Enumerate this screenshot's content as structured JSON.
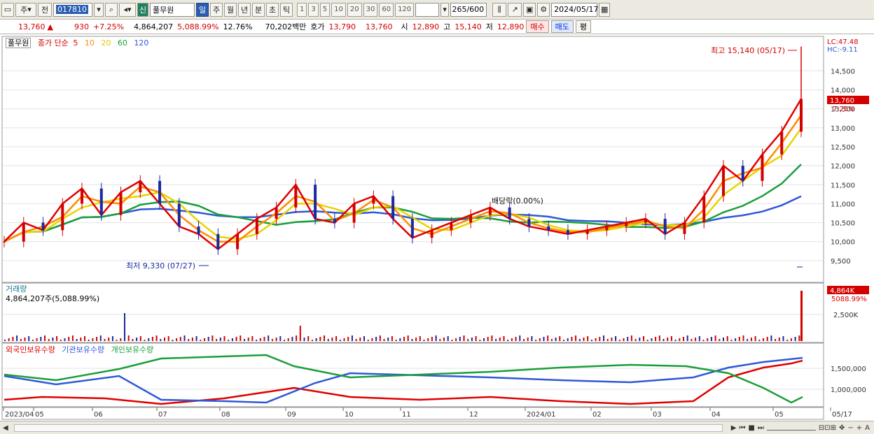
{
  "toolbar": {
    "market_label": "주",
    "prev_label": "전",
    "code_value": "017810",
    "stock_badge": "신",
    "stock_name": "풀무원",
    "periods": [
      "일",
      "주",
      "월",
      "년",
      "분",
      "초",
      "틱"
    ],
    "selected_period": "일",
    "intervals": [
      "1",
      "3",
      "5",
      "10",
      "20",
      "30",
      "60",
      "120"
    ],
    "count_value": "265",
    "count_total": "/600",
    "date_value": "2024/05/17"
  },
  "quote": {
    "price": "13,760",
    "arrow": "▲",
    "change": "930",
    "change_pct": "+7.25%",
    "volume": "4,864,207",
    "volume_pct": "5,088.99%",
    "turnover": "12.76%",
    "amount": "70,202백만",
    "ask_label": "호가",
    "ask": "13,790",
    "bid": "13,760",
    "open_label": "시",
    "open": "12,890",
    "high_label": "고",
    "high": "15,140",
    "low_label": "저",
    "low": "12,890",
    "buy_label": "매수",
    "sell_label": "매도",
    "eval_label": "평"
  },
  "price_panel": {
    "title": "풀무원",
    "ma_label": "종가 단순",
    "ma_periods": [
      "5",
      "10",
      "20",
      "60",
      "120"
    ],
    "ma_colors": [
      "#e00000",
      "#ff8c00",
      "#e8d400",
      "#1a9e3a",
      "#2f58d8"
    ],
    "lc_label": "LC:47.48",
    "hc_label": "HC:-9.11",
    "price_tag": "13,760",
    "pct_tag": "7.25%",
    "high_note": "최고 15,140 (05/17)",
    "low_note": "최저 9,330 (07/27)",
    "dividend_note": "배당락(0.00%)",
    "y_ticks": [
      "14,500",
      "14,000",
      "13,500",
      "13,000",
      "12,500",
      "12,000",
      "11,500",
      "11,000",
      "10,500",
      "10,000",
      "9,500"
    ]
  },
  "volume_panel": {
    "title": "거래량",
    "readout": "4,864,207주(5,088.99%)",
    "tag": "4,864K",
    "pct": "5088.99%",
    "y_ticks": [
      "2,500K"
    ]
  },
  "holdings_panel": {
    "series": [
      "외국인보유수량",
      "기관보유수량",
      "개인보유수량"
    ],
    "series_colors": [
      "#e00000",
      "#2f58d8",
      "#1a9e3a"
    ],
    "y_ticks": [
      "1,500,000",
      "1,000,000"
    ]
  },
  "x_axis": {
    "labels": [
      "2023/04",
      "05",
      "06",
      "07",
      "08",
      "09",
      "10",
      "11",
      "12",
      "2024/01",
      "02",
      "03",
      "04",
      "05",
      "05/17"
    ]
  },
  "chart_data": {
    "type": "line",
    "title": "",
    "ylim": [
      9000,
      15300
    ],
    "series": [
      {
        "name": "종가",
        "values": [
          10000,
          10500,
          10300,
          11000,
          11400,
          10700,
          11300,
          11600,
          11000,
          10400,
          10200,
          9800,
          10200,
          10600,
          10900,
          11500,
          10600,
          10500,
          11000,
          11200,
          10600,
          10100,
          10300,
          10500,
          10700,
          10900,
          10600,
          10400,
          10300,
          10200,
          10300,
          10400,
          10500,
          10600,
          10200,
          10500,
          11200,
          12000,
          11600,
          12300,
          12900,
          13760
        ]
      }
    ],
    "high": 15140,
    "low": 9330
  },
  "icons": {
    "search": "search-icon",
    "settings": "gear-icon",
    "calendar": "calendar-icon",
    "save": "save-icon"
  }
}
